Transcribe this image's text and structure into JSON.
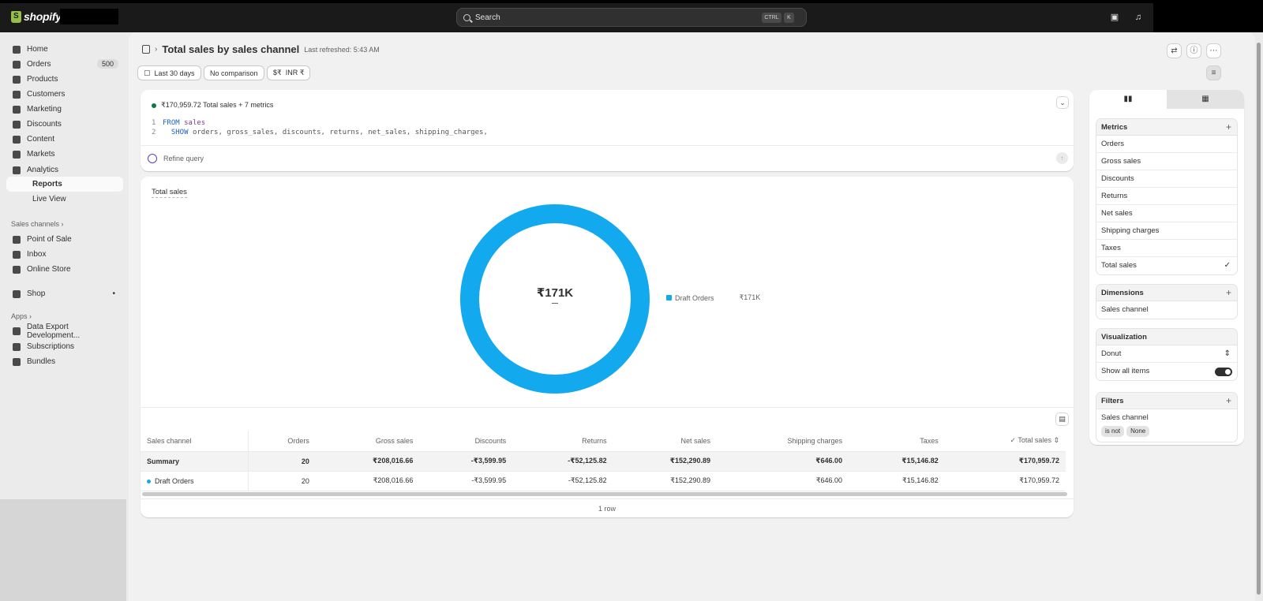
{
  "topbar": {
    "brand": "shopify",
    "search_placeholder": "Search",
    "kbd_ctrl": "CTRL",
    "kbd_k": "K"
  },
  "sidebar": {
    "items": [
      {
        "label": "Home",
        "icon": "home-icon"
      },
      {
        "label": "Orders",
        "icon": "orders-icon",
        "badge": "500"
      },
      {
        "label": "Products",
        "icon": "tag-icon"
      },
      {
        "label": "Customers",
        "icon": "person-icon"
      },
      {
        "label": "Marketing",
        "icon": "target-icon"
      },
      {
        "label": "Discounts",
        "icon": "discount-icon"
      },
      {
        "label": "Content",
        "icon": "content-icon"
      },
      {
        "label": "Markets",
        "icon": "globe-icon"
      },
      {
        "label": "Analytics",
        "icon": "bar-chart-icon"
      },
      {
        "label": "Reports",
        "icon": "",
        "active": true
      },
      {
        "label": "Live View",
        "icon": ""
      }
    ],
    "sales_channels_label": "Sales channels",
    "channels": [
      {
        "label": "Point of Sale",
        "icon": "pos-icon"
      },
      {
        "label": "Inbox",
        "icon": "inbox-icon"
      },
      {
        "label": "Online Store",
        "icon": "store-icon"
      }
    ],
    "shop": {
      "label": "Shop",
      "icon": "shop-icon",
      "dot": "•"
    },
    "apps_label": "Apps",
    "apps": [
      {
        "label": "Data Export Development...",
        "icon": "app-icon"
      },
      {
        "label": "Subscriptions",
        "icon": "app-icon"
      },
      {
        "label": "Bundles",
        "icon": "app-icon"
      }
    ]
  },
  "header": {
    "title": "Total sales by sales channel",
    "last_refreshed": "Last refreshed: 5:43 AM",
    "chips": {
      "date": "Last 30 days",
      "comparison": "No comparison",
      "currency": "INR ₹"
    }
  },
  "query": {
    "summary": "₹170,959.72 Total sales + 7 metrics",
    "lines": [
      {
        "n": "1",
        "kw": "FROM",
        "rest": "sales"
      },
      {
        "n": "2",
        "kw": "SHOW",
        "rest": "orders, gross_sales, discounts, returns, net_sales, shipping_charges,"
      }
    ],
    "refine_placeholder": "Refine query"
  },
  "chart": {
    "section_title": "Total sales",
    "center_label": "₹171K",
    "legend_value": "₹171K",
    "colors": {
      "series": "#13a9ee",
      "accent_check": "#0a7a46"
    }
  },
  "chart_data": {
    "type": "pie",
    "title": "Total sales",
    "categories": [
      "Draft Orders"
    ],
    "values": [
      170959.72
    ],
    "legend": "right"
  },
  "table": {
    "headers": [
      "Sales channel",
      "Orders",
      "Gross sales",
      "Discounts",
      "Returns",
      "Net sales",
      "Shipping charges",
      "Taxes",
      "Total sales"
    ],
    "summary": [
      "Summary",
      "20",
      "₹208,016.66",
      "-₹3,599.95",
      "-₹52,125.82",
      "₹152,290.89",
      "₹646.00",
      "₹15,146.82",
      "₹170,959.72"
    ],
    "rows": [
      [
        "Draft Orders",
        "20",
        "₹208,016.66",
        "-₹3,599.95",
        "-₹52,125.82",
        "₹152,290.89",
        "₹646.00",
        "₹15,146.82",
        "₹170,959.72"
      ]
    ],
    "row_count": "1 row"
  },
  "panel": {
    "metrics_label": "Metrics",
    "metrics": [
      "Orders",
      "Gross sales",
      "Discounts",
      "Returns",
      "Net sales",
      "Shipping charges",
      "Taxes",
      "Total sales"
    ],
    "dimensions_label": "Dimensions",
    "dimensions": [
      "Sales channel"
    ],
    "visualization_label": "Visualization",
    "visualization_value": "Donut",
    "show_all_label": "Show all items",
    "filters_label": "Filters",
    "filter_field": "Sales channel",
    "filter_op": "is not",
    "filter_value": "None"
  }
}
